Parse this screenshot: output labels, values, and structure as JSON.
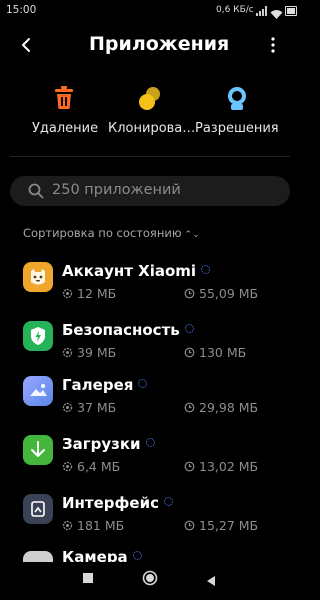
{
  "status_bar": {
    "time": "15:00",
    "speed": "0,6 КБ/с"
  },
  "header": {
    "title": "Приложения"
  },
  "actions": [
    {
      "label": "Удаление",
      "icon": "trash-icon",
      "color": "#ff6a1f"
    },
    {
      "label": "Клонирова…",
      "icon": "clone-icon",
      "color": "#f5c018"
    },
    {
      "label": "Разрешения",
      "icon": "permissions-icon",
      "color": "#6bc6ff"
    }
  ],
  "search": {
    "placeholder": "250 приложений"
  },
  "sort": {
    "label": "Сортировка по состоянию"
  },
  "apps": [
    {
      "name": "Аккаунт Xiaomi",
      "storage": "12 МБ",
      "cache": "55,09 МБ",
      "icon": "xiaomi-account-icon",
      "color": "#f0a52d"
    },
    {
      "name": "Безопасность",
      "storage": "39 МБ",
      "cache": "130 МБ",
      "icon": "security-icon",
      "color": "#25b35a"
    },
    {
      "name": "Галерея",
      "storage": "37 МБ",
      "cache": "29,98 МБ",
      "icon": "gallery-icon",
      "color": "#6d85e8"
    },
    {
      "name": "Загрузки",
      "storage": "6,4 МБ",
      "cache": "13,02 МБ",
      "icon": "downloads-icon",
      "color": "#45b63c"
    },
    {
      "name": "Интерфейс",
      "storage": "181 МБ",
      "cache": "15,27 МБ",
      "icon": "interface-icon",
      "color": "#3a4255"
    },
    {
      "name": "Камера",
      "storage": "",
      "cache": "",
      "icon": "camera-icon",
      "color": "#cfcfcf"
    }
  ]
}
